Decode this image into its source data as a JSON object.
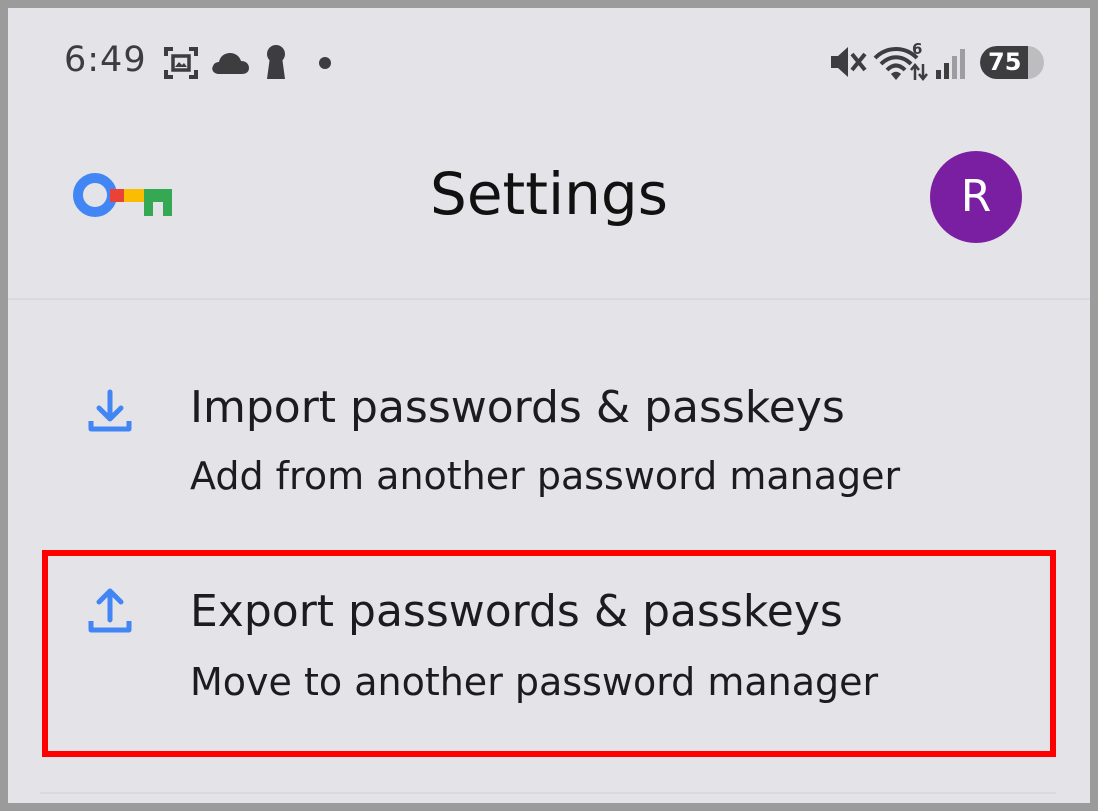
{
  "status_bar": {
    "time": "6:49",
    "battery": "75",
    "network_badge": "6",
    "icons": [
      "screenshot-icon",
      "cloud-icon",
      "keyhole-icon",
      "dot-icon",
      "mute-icon",
      "wifi-icon",
      "signal-icon",
      "battery-icon"
    ]
  },
  "app_bar": {
    "title": "Settings",
    "avatar_initial": "R",
    "logo": "password-manager-key-logo"
  },
  "rows": [
    {
      "title": "Import passwords & passkeys",
      "subtitle": "Add from another password manager",
      "icon": "download-icon"
    },
    {
      "title": "Export passwords & passkeys",
      "subtitle": "Move to another password manager",
      "icon": "upload-icon",
      "highlighted": true
    }
  ],
  "colors": {
    "background": "#e4e4e8",
    "accent_blue": "#4285f4",
    "avatar": "#7b1fa2",
    "highlight": "#ff0000"
  }
}
